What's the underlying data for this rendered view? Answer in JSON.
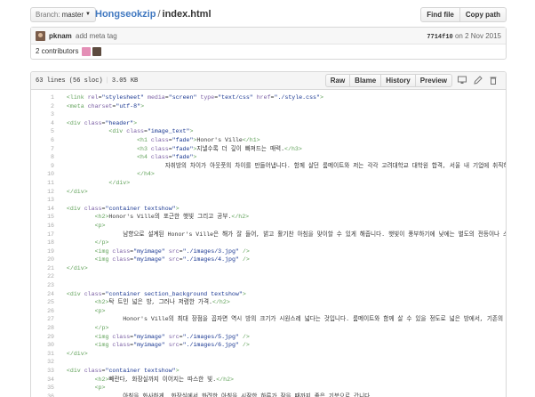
{
  "topbar": {
    "branch_label": "Branch:",
    "branch_name": "master",
    "repo": "Hongseokzip",
    "separator": "/",
    "file": "index.html",
    "find_file": "Find file",
    "copy_path": "Copy path"
  },
  "commit": {
    "author": "pknam",
    "message": "add meta tag",
    "sha": "7714f10",
    "date": "on 2 Nov 2015",
    "contributors": "2 contributors"
  },
  "file": {
    "lines": "63 lines (56 sloc)",
    "size": "3.05 KB",
    "raw": "Raw",
    "blame": "Blame",
    "history": "History",
    "preview": "Preview",
    "icons": [
      "desktop-icon",
      "pencil-icon",
      "trash-icon"
    ]
  },
  "code": [
    {
      "n": "1",
      "segs": [
        [
          "p",
          "  "
        ],
        [
          "t",
          "<link"
        ],
        [
          "p",
          " "
        ],
        [
          "a",
          "rel"
        ],
        [
          "p",
          "="
        ],
        [
          "s",
          "\"stylesheet\""
        ],
        [
          "p",
          " "
        ],
        [
          "a",
          "media"
        ],
        [
          "p",
          "="
        ],
        [
          "s",
          "\"screen\""
        ],
        [
          "p",
          " "
        ],
        [
          "a",
          "type"
        ],
        [
          "p",
          "="
        ],
        [
          "s",
          "\"text/css\""
        ],
        [
          "p",
          " "
        ],
        [
          "a",
          "href"
        ],
        [
          "p",
          "="
        ],
        [
          "s",
          "\"./style.css\""
        ],
        [
          "t",
          ">"
        ]
      ]
    },
    {
      "n": "2",
      "segs": [
        [
          "p",
          "  "
        ],
        [
          "t",
          "<meta"
        ],
        [
          "p",
          " "
        ],
        [
          "a",
          "charset"
        ],
        [
          "p",
          "="
        ],
        [
          "s",
          "\"utf-8\""
        ],
        [
          "t",
          ">"
        ]
      ]
    },
    {
      "n": "3",
      "segs": [
        [
          "p",
          " "
        ]
      ]
    },
    {
      "n": "4",
      "segs": [
        [
          "p",
          "  "
        ],
        [
          "t",
          "<div"
        ],
        [
          "p",
          " "
        ],
        [
          "a",
          "class"
        ],
        [
          "p",
          "="
        ],
        [
          "s",
          "\"header\""
        ],
        [
          "t",
          ">"
        ]
      ]
    },
    {
      "n": "5",
      "segs": [
        [
          "p",
          "              "
        ],
        [
          "t",
          "<div"
        ],
        [
          "p",
          " "
        ],
        [
          "a",
          "class"
        ],
        [
          "p",
          "="
        ],
        [
          "s",
          "\"image_text\""
        ],
        [
          "t",
          ">"
        ]
      ]
    },
    {
      "n": "6",
      "segs": [
        [
          "p",
          "                      "
        ],
        [
          "t",
          "<h1"
        ],
        [
          "p",
          " "
        ],
        [
          "a",
          "class"
        ],
        [
          "p",
          "="
        ],
        [
          "s",
          "\"fade\""
        ],
        [
          "t",
          ">"
        ],
        [
          "p",
          "Honor's Ville"
        ],
        [
          "t",
          "</h1>"
        ]
      ]
    },
    {
      "n": "7",
      "segs": [
        [
          "p",
          "                      "
        ],
        [
          "t",
          "<h3"
        ],
        [
          "p",
          " "
        ],
        [
          "a",
          "class"
        ],
        [
          "p",
          "="
        ],
        [
          "s",
          "\"fade\""
        ],
        [
          "t",
          ">"
        ],
        [
          "p",
          "지낼수록 더 깊이 빠져드는 매력."
        ],
        [
          "t",
          "</h3>"
        ]
      ]
    },
    {
      "n": "8",
      "segs": [
        [
          "p",
          "                      "
        ],
        [
          "t",
          "<h4"
        ],
        [
          "p",
          " "
        ],
        [
          "a",
          "class"
        ],
        [
          "p",
          "="
        ],
        [
          "s",
          "\"fade\""
        ],
        [
          "t",
          ">"
        ]
      ]
    },
    {
      "n": "9",
      "segs": [
        [
          "p",
          "                              자취방의 차이가 아웃풋의 차이를 만들어냅니다. 함께 살던 룸메이트와 저는 각각 고려대학교 대학원 합격, 서울 내 기업에 취직하였습니다"
        ]
      ]
    },
    {
      "n": "10",
      "segs": [
        [
          "p",
          "                      "
        ],
        [
          "t",
          "</h4>"
        ]
      ]
    },
    {
      "n": "11",
      "segs": [
        [
          "p",
          "              "
        ],
        [
          "t",
          "</div>"
        ]
      ]
    },
    {
      "n": "12",
      "segs": [
        [
          "p",
          "  "
        ],
        [
          "t",
          "</div>"
        ]
      ]
    },
    {
      "n": "13",
      "segs": [
        [
          "p",
          " "
        ]
      ]
    },
    {
      "n": "14",
      "segs": [
        [
          "p",
          "  "
        ],
        [
          "t",
          "<div"
        ],
        [
          "p",
          " "
        ],
        [
          "a",
          "class"
        ],
        [
          "p",
          "="
        ],
        [
          "s",
          "\"container textshow\""
        ],
        [
          "t",
          ">"
        ]
      ]
    },
    {
      "n": "15",
      "segs": [
        [
          "p",
          "          "
        ],
        [
          "t",
          "<h2>"
        ],
        [
          "p",
          "Honor's Ville의 포근한 햇빛 그리고 공부."
        ],
        [
          "t",
          "</h2>"
        ]
      ]
    },
    {
      "n": "16",
      "segs": [
        [
          "p",
          "          "
        ],
        [
          "t",
          "<p>"
        ]
      ]
    },
    {
      "n": "17",
      "segs": [
        [
          "p",
          "                  남향으로 설계된 Honor's Ville은 해가 잘 들어, 밝고 활기찬 아침을 맞이할 수 있게 해줍니다. 햇빛이 풍부하기에 낮에는 별도의 전등이나 스탠드"
        ]
      ]
    },
    {
      "n": "18",
      "segs": [
        [
          "p",
          "          "
        ],
        [
          "t",
          "</p>"
        ]
      ]
    },
    {
      "n": "19",
      "segs": [
        [
          "p",
          "          "
        ],
        [
          "t",
          "<img"
        ],
        [
          "p",
          " "
        ],
        [
          "a",
          "class"
        ],
        [
          "p",
          "="
        ],
        [
          "s",
          "\"myimage\""
        ],
        [
          "p",
          " "
        ],
        [
          "a",
          "src"
        ],
        [
          "p",
          "="
        ],
        [
          "s",
          "\"./images/3.jpg\""
        ],
        [
          "p",
          " "
        ],
        [
          "t",
          "/>"
        ]
      ]
    },
    {
      "n": "20",
      "segs": [
        [
          "p",
          "          "
        ],
        [
          "t",
          "<img"
        ],
        [
          "p",
          " "
        ],
        [
          "a",
          "class"
        ],
        [
          "p",
          "="
        ],
        [
          "s",
          "\"myimage\""
        ],
        [
          "p",
          " "
        ],
        [
          "a",
          "src"
        ],
        [
          "p",
          "="
        ],
        [
          "s",
          "\"./images/4.jpg\""
        ],
        [
          "p",
          " "
        ],
        [
          "t",
          "/>"
        ]
      ]
    },
    {
      "n": "21",
      "segs": [
        [
          "p",
          "  "
        ],
        [
          "t",
          "</div>"
        ]
      ]
    },
    {
      "n": "22",
      "segs": [
        [
          "p",
          " "
        ]
      ]
    },
    {
      "n": "23",
      "segs": [
        [
          "p",
          " "
        ]
      ]
    },
    {
      "n": "24",
      "segs": [
        [
          "p",
          "  "
        ],
        [
          "t",
          "<div"
        ],
        [
          "p",
          " "
        ],
        [
          "a",
          "class"
        ],
        [
          "p",
          "="
        ],
        [
          "s",
          "\"container section_background textshow\""
        ],
        [
          "t",
          ">"
        ]
      ]
    },
    {
      "n": "25",
      "segs": [
        [
          "p",
          "          "
        ],
        [
          "t",
          "<h2>"
        ],
        [
          "p",
          "탁 트인 넓은 방, 그러나 저렴한 가격."
        ],
        [
          "t",
          "</h2>"
        ]
      ]
    },
    {
      "n": "26",
      "segs": [
        [
          "p",
          "          "
        ],
        [
          "t",
          "<p>"
        ]
      ]
    },
    {
      "n": "27",
      "segs": [
        [
          "p",
          "                  Honor's Ville의 최대 장점을 꼽자면 역시 방의 크기가 시원스레 넓다는 것입니다. 룸메이트와 함께 살 수 있을 정도로 넓은 방에서, 기존의 좁"
        ]
      ]
    },
    {
      "n": "28",
      "segs": [
        [
          "p",
          "          "
        ],
        [
          "t",
          "</p>"
        ]
      ]
    },
    {
      "n": "29",
      "segs": [
        [
          "p",
          "          "
        ],
        [
          "t",
          "<img"
        ],
        [
          "p",
          " "
        ],
        [
          "a",
          "class"
        ],
        [
          "p",
          "="
        ],
        [
          "s",
          "\"myimage\""
        ],
        [
          "p",
          " "
        ],
        [
          "a",
          "src"
        ],
        [
          "p",
          "="
        ],
        [
          "s",
          "\"./images/5.jpg\""
        ],
        [
          "p",
          " "
        ],
        [
          "t",
          "/>"
        ]
      ]
    },
    {
      "n": "30",
      "segs": [
        [
          "p",
          "          "
        ],
        [
          "t",
          "<img"
        ],
        [
          "p",
          " "
        ],
        [
          "a",
          "class"
        ],
        [
          "p",
          "="
        ],
        [
          "s",
          "\"myimage\""
        ],
        [
          "p",
          " "
        ],
        [
          "a",
          "src"
        ],
        [
          "p",
          "="
        ],
        [
          "s",
          "\"./images/6.jpg\""
        ],
        [
          "p",
          " "
        ],
        [
          "t",
          "/>"
        ]
      ]
    },
    {
      "n": "31",
      "segs": [
        [
          "p",
          "  "
        ],
        [
          "t",
          "</div>"
        ]
      ]
    },
    {
      "n": "32",
      "segs": [
        [
          "p",
          " "
        ]
      ]
    },
    {
      "n": "33",
      "segs": [
        [
          "p",
          "  "
        ],
        [
          "t",
          "<div"
        ],
        [
          "p",
          " "
        ],
        [
          "a",
          "class"
        ],
        [
          "p",
          "="
        ],
        [
          "s",
          "\"container textshow\""
        ],
        [
          "t",
          ">"
        ]
      ]
    },
    {
      "n": "34",
      "segs": [
        [
          "p",
          "          "
        ],
        [
          "t",
          "<h2>"
        ],
        [
          "p",
          "빼란다, 화장실까지 이어지는 따스한 빛."
        ],
        [
          "t",
          "</h2>"
        ]
      ]
    },
    {
      "n": "35",
      "segs": [
        [
          "p",
          "          "
        ],
        [
          "t",
          "<p>"
        ]
      ]
    },
    {
      "n": "36",
      "segs": [
        [
          "p",
          "                  아침을 화사하게. 화장실에서 화려한 아침을 시작한 하루가 잠을 때까지 좋은 기분으로 갑니다."
        ]
      ]
    }
  ]
}
